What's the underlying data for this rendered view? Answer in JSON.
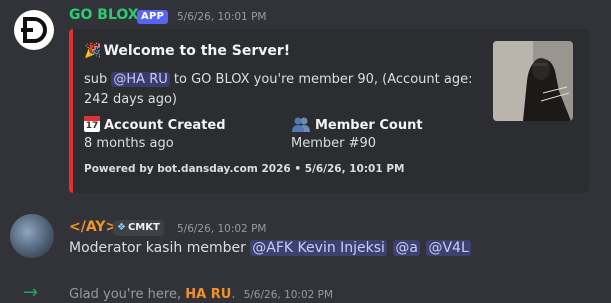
{
  "message1": {
    "author": "GO BLOX",
    "tag": "APP",
    "timestamp": "5/6/26, 10:01 PM",
    "embed": {
      "accent_color": "#e03030",
      "title_icon": "party-popper-icon",
      "title": "Welcome to the Server!",
      "desc_prefix": "sub",
      "desc_mention": "@HA RU",
      "desc_suffix": "to GO BLOX you're member 90, (Account age: 242 days ago)",
      "fields": [
        {
          "icon": "calendar-icon",
          "calendar_day": "17",
          "name": "Account Created",
          "value": "8 months ago"
        },
        {
          "icon": "people-icon",
          "name": "Member Count",
          "value": "Member #90"
        }
      ],
      "footer": "Powered by bot.dansday.com 2026 • 5/6/26, 10:01 PM"
    }
  },
  "message2": {
    "author": "</AY>",
    "clan_tag": "CMKT",
    "timestamp": "5/6/26, 10:02 PM",
    "text": "Moderator kasih member",
    "mentions": [
      "@AFK Kevin Injeksi",
      "@a",
      "@V4L"
    ]
  },
  "system_message": {
    "prefix": "Glad you're here,",
    "user": "HA RU",
    "suffix": ".",
    "timestamp": "5/6/26, 10:02 PM"
  }
}
